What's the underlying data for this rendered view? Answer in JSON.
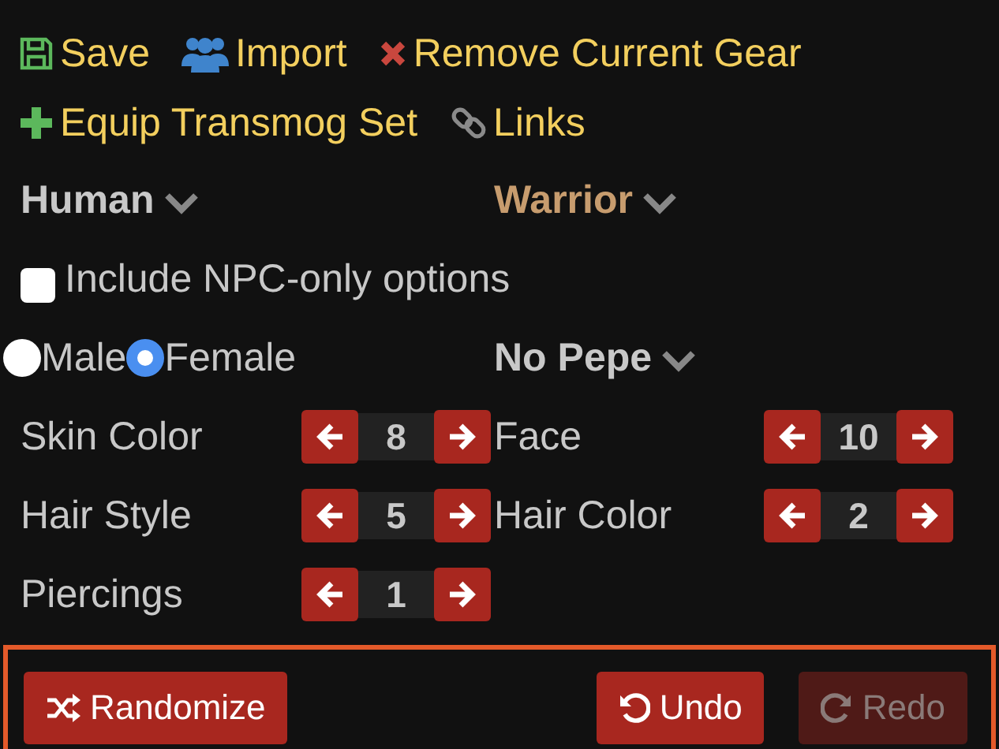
{
  "toolbar": [
    {
      "kind": "save",
      "label": "Save"
    },
    {
      "kind": "import",
      "label": "Import"
    },
    {
      "kind": "remove",
      "label": "Remove Current Gear"
    },
    {
      "kind": "equip",
      "label": "Equip Transmog Set"
    },
    {
      "kind": "links",
      "label": "Links"
    }
  ],
  "race": {
    "label": "Human"
  },
  "class": {
    "label": "Warrior"
  },
  "npc_option": {
    "label": "Include NPC-only options",
    "checked": false
  },
  "gender": [
    {
      "label": "Male",
      "selected": false
    },
    {
      "label": "Female",
      "selected": true
    }
  ],
  "variant": {
    "label": "No Pepe"
  },
  "steppers": [
    {
      "label": "Skin Color",
      "value": "8"
    },
    {
      "label": "Face",
      "value": "10"
    },
    {
      "label": "Hair Style",
      "value": "5"
    },
    {
      "label": "Hair Color",
      "value": "2"
    },
    {
      "label": "Piercings",
      "value": "1"
    }
  ],
  "footer_buttons": [
    {
      "kind": "randomize",
      "label": "Randomize",
      "disabled": false
    },
    {
      "kind": "undo",
      "label": "Undo",
      "disabled": false
    },
    {
      "kind": "redo",
      "label": "Redo",
      "disabled": true
    }
  ]
}
